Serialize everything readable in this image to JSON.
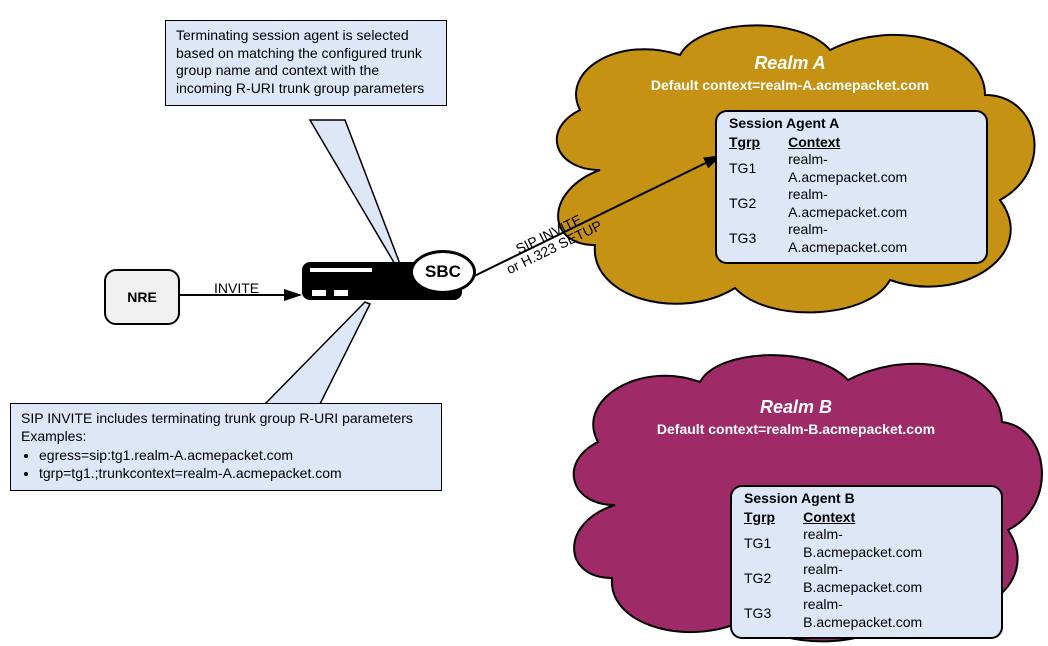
{
  "nre": {
    "label": "NRE"
  },
  "sbc": {
    "label": "SBC"
  },
  "link_labels": {
    "invite": "INVITE",
    "sip_invite": "SIP INVITE",
    "h323_setup": "or H.323 SETUP"
  },
  "callout_top": {
    "text": "Terminating session agent is selected based on matching the configured trunk group name and context with the incoming R-URI trunk group parameters"
  },
  "callout_bottom": {
    "line1": "SIP INVITE includes terminating trunk group R-URI parameters",
    "line2": "Examples:",
    "bullets": [
      "egress=sip:tg1.realm-A.acmepacket.com",
      "tgrp=tg1.;trunkcontext=realm-A.acmepacket.com"
    ]
  },
  "realm_a": {
    "title": "Realm A",
    "subtitle": "Default context=realm-A.acmepacket.com",
    "agent": {
      "title": "Session Agent A",
      "th_tgrp": "Tgrp",
      "th_ctx": "Context",
      "rows": [
        {
          "tgrp": "TG1",
          "ctx": "realm-A.acmepacket.com"
        },
        {
          "tgrp": "TG2",
          "ctx": "realm-A.acmepacket.com"
        },
        {
          "tgrp": "TG3",
          "ctx": "realm-A.acmepacket.com"
        }
      ]
    }
  },
  "realm_b": {
    "title": "Realm B",
    "subtitle": "Default context=realm-B.acmepacket.com",
    "agent": {
      "title": "Session Agent B",
      "th_tgrp": "Tgrp",
      "th_ctx": "Context",
      "rows": [
        {
          "tgrp": "TG1",
          "ctx": "realm-B.acmepacket.com"
        },
        {
          "tgrp": "TG2",
          "ctx": "realm-B.acmepacket.com"
        },
        {
          "tgrp": "TG3",
          "ctx": "realm-B.acmepacket.com"
        }
      ]
    }
  },
  "colors": {
    "realm_a": "#c69214",
    "realm_b": "#9e2a68",
    "callout_bg": "#dee7f7"
  }
}
